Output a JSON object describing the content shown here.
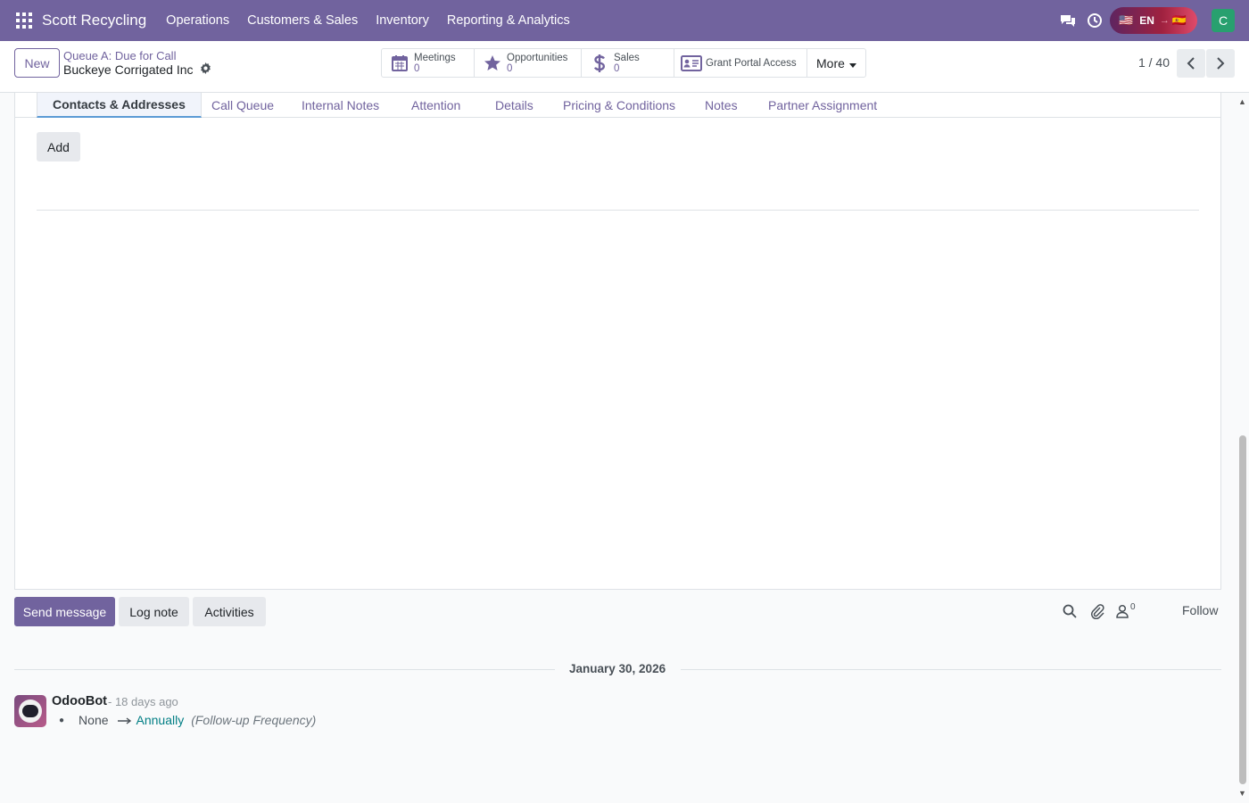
{
  "navbar": {
    "brand": "Scott Recycling",
    "menu": [
      "Operations",
      "Customers & Sales",
      "Inventory",
      "Reporting & Analytics"
    ],
    "lang_from": "EN",
    "user_initial": "C"
  },
  "control": {
    "new_label": "New",
    "breadcrumb_parent": "Queue A: Due for Call",
    "breadcrumb_current": "Buckeye Corrigated Inc",
    "smart_buttons": [
      {
        "label": "Meetings",
        "value": "0"
      },
      {
        "label": "Opportunities",
        "value": "0"
      },
      {
        "label": "Sales",
        "value": "0"
      }
    ],
    "portal_label": "Grant Portal Access",
    "more_label": "More",
    "pager": "1 / 40"
  },
  "sheet": {
    "tabs": [
      "Contacts & Addresses",
      "Call Queue",
      "Internal Notes",
      "Attention",
      "Details",
      "Pricing & Conditions",
      "Notes",
      "Partner Assignment"
    ],
    "add_label": "Add"
  },
  "chatter": {
    "send_message": "Send message",
    "log_note": "Log note",
    "activities": "Activities",
    "follower_count": "0",
    "follow": "Follow",
    "date": "January 30, 2026",
    "message": {
      "author": "OdooBot",
      "time": "- 18 days ago",
      "old_value": "None",
      "new_value": "Annually",
      "field": "(Follow-up Frequency)"
    }
  },
  "colors": {
    "brand": "#71639e",
    "link_teal": "#017e84",
    "user_avatar": "#28a06f"
  }
}
